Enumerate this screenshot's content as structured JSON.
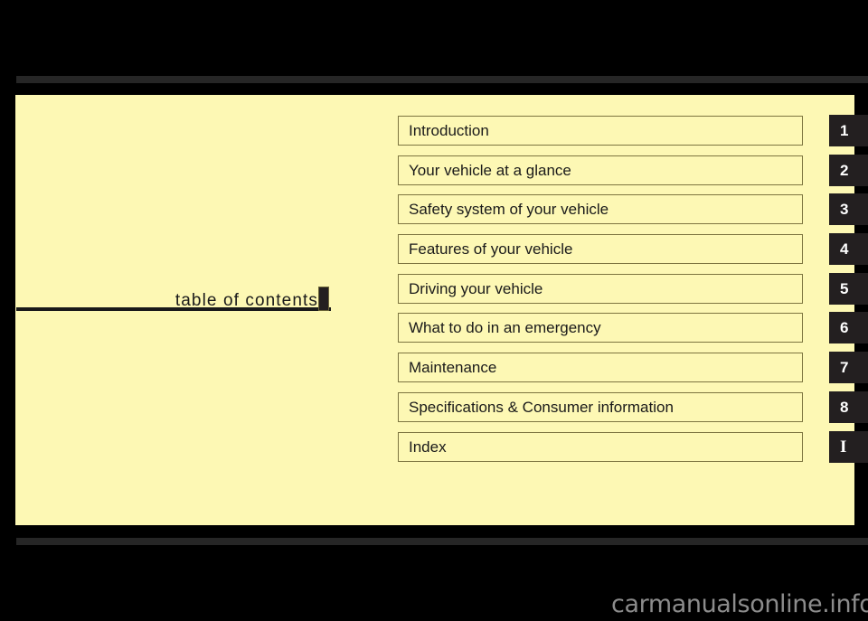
{
  "page": {
    "background_color": "#000000",
    "panel_color": "#FDF8B4",
    "rule_color": "#262626",
    "tab_color": "#231f20",
    "border_color": "#7d7540"
  },
  "title": {
    "text": "table of contents"
  },
  "contents": {
    "items": [
      {
        "label": "Introduction",
        "tab": "1"
      },
      {
        "label": "Your vehicle at a glance",
        "tab": "2"
      },
      {
        "label": "Safety system of your vehicle",
        "tab": "3"
      },
      {
        "label": "Features of your vehicle",
        "tab": "4"
      },
      {
        "label": "Driving your vehicle",
        "tab": "5"
      },
      {
        "label": "What to do in an emergency",
        "tab": "6"
      },
      {
        "label": "Maintenance",
        "tab": "7"
      },
      {
        "label": "Specifications & Consumer information",
        "tab": "8"
      },
      {
        "label": "Index",
        "tab": "I"
      }
    ]
  },
  "watermark": {
    "text": "carmanualsonline.info"
  }
}
